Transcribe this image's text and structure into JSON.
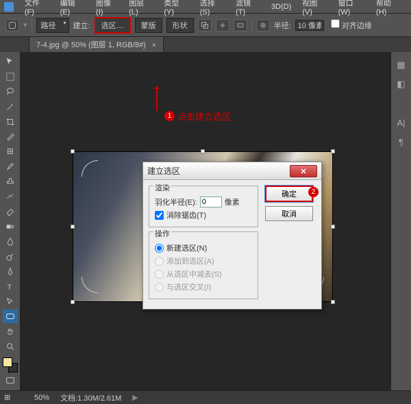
{
  "menu": [
    "文件(F)",
    "编辑(E)",
    "图像(I)",
    "图层(L)",
    "类型(Y)",
    "选择(S)",
    "滤镜(T)",
    "3D(D)",
    "视图(V)",
    "窗口(W)",
    "帮助(H)"
  ],
  "optbar": {
    "path_label": "路径",
    "build_label": "建立:",
    "selection_btn": "选区…",
    "mask_btn": "蒙版",
    "shape_btn": "形状",
    "radius_label": "半径:",
    "radius_value": "10 像素",
    "align_edges": "对齐边缘"
  },
  "tab": {
    "label": "7-4.jpg @ 50% (图层 1, RGB/8#)"
  },
  "annotation": {
    "num": "1",
    "text": "点击建立选区"
  },
  "dialog": {
    "title": "建立选区",
    "render_legend": "渲染",
    "feather_label": "羽化半径(E):",
    "feather_value": "0",
    "feather_unit": "像素",
    "antialias": "消除锯齿(T)",
    "op_legend": "操作",
    "op_new": "新建选区(N)",
    "op_add": "添加到选区(A)",
    "op_sub": "从选区中减去(S)",
    "op_int": "与选区交叉(I)",
    "ok": "确定",
    "cancel": "取消",
    "ok_num": "2"
  },
  "status": {
    "zoom": "50%",
    "doc": "文档:1.30M/2.61M"
  },
  "right_icons": [
    "▦",
    "◧",
    "A|",
    "¶"
  ]
}
